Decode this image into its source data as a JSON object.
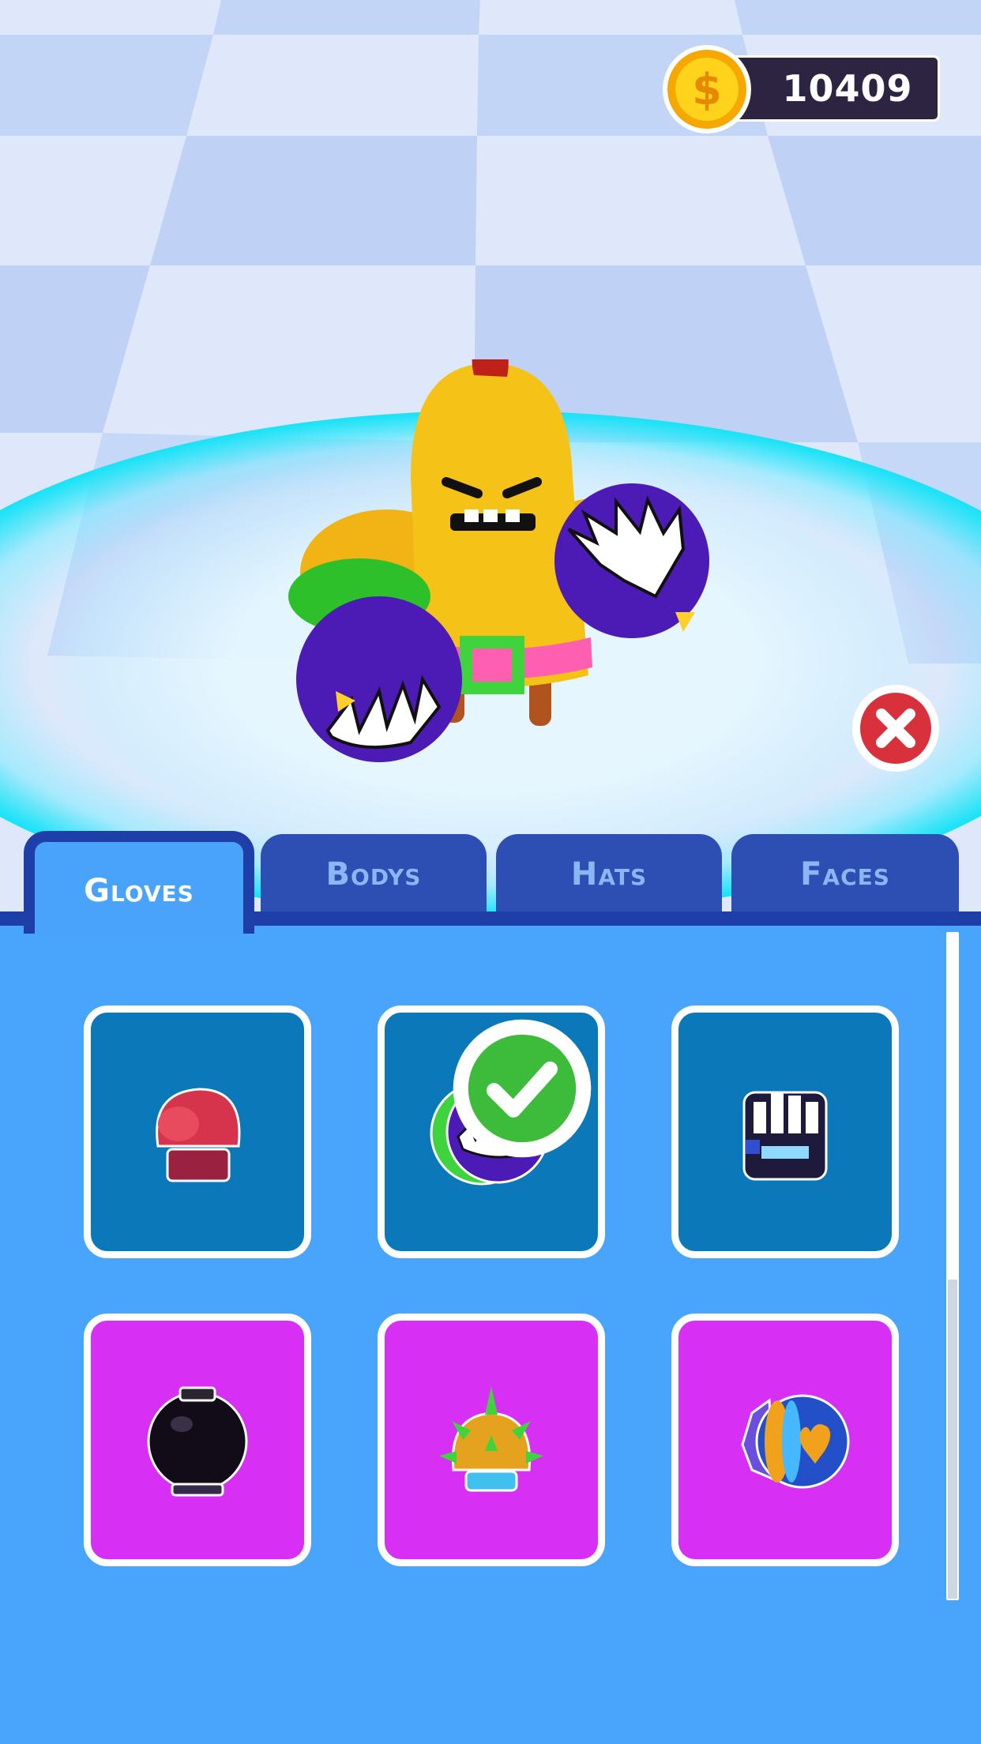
{
  "coins": {
    "amount": "10409",
    "icon": "dollar-coin-icon"
  },
  "close": {
    "icon": "close-icon"
  },
  "tabs": [
    {
      "label": "Gloves",
      "active": true
    },
    {
      "label": "Bodys",
      "active": false
    },
    {
      "label": "Hats",
      "active": false
    },
    {
      "label": "Faces",
      "active": false
    }
  ],
  "items": [
    {
      "name": "red-boxing-glove-icon",
      "bg": "blue",
      "equipped": false
    },
    {
      "name": "purple-monster-glove-icon",
      "bg": "blue",
      "equipped": true
    },
    {
      "name": "robot-fist-glove-icon",
      "bg": "blue",
      "equipped": false
    },
    {
      "name": "black-bomb-glove-icon",
      "bg": "pink",
      "equipped": false
    },
    {
      "name": "spiked-gold-glove-icon",
      "bg": "pink",
      "equipped": false
    },
    {
      "name": "heart-striped-glove-icon",
      "bg": "pink",
      "equipped": false
    }
  ],
  "colors": {
    "panel": "#49a4fc",
    "tab_inactive": "#2d4fb3",
    "tab_border": "#1f3fa8",
    "slot_blue": "#0b78b9",
    "slot_pink": "#d72ff4",
    "glow": "#12d8f2"
  }
}
